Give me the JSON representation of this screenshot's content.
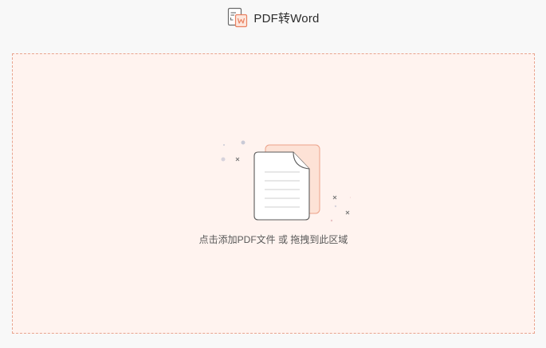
{
  "header": {
    "title": "PDF转Word",
    "icon": "pdf-to-word-icon"
  },
  "dropzone": {
    "hint": "点击添加PDF文件 或 拖拽到此区域",
    "illustration": "document-upload-illustration"
  },
  "colors": {
    "accent": "#e9805f",
    "dropzone_bg": "#fff3ef",
    "dropzone_border": "#e9a48f",
    "page_bg": "#f8f8f8"
  }
}
